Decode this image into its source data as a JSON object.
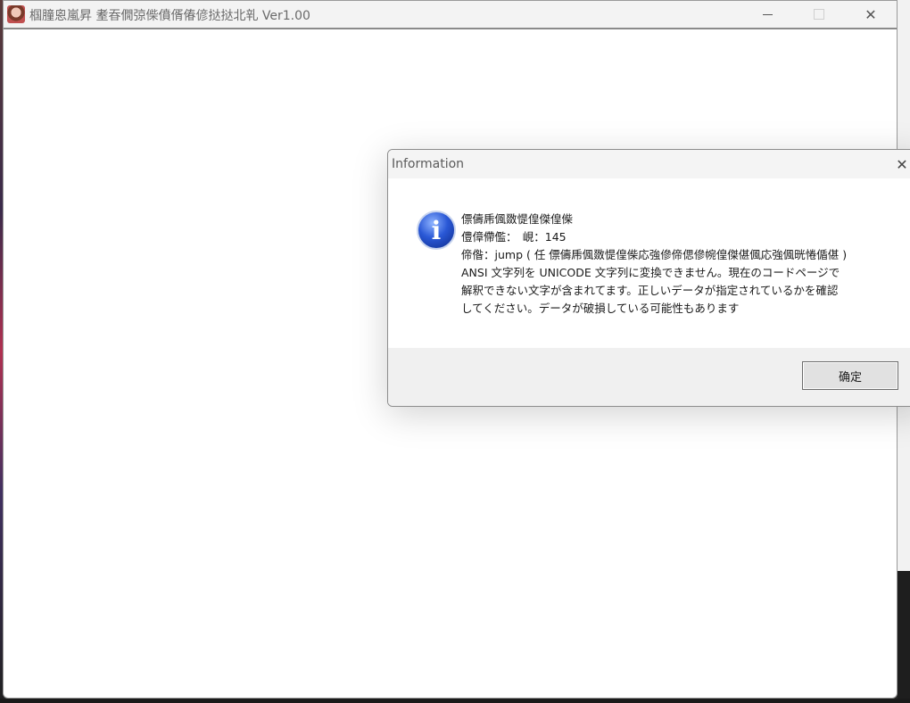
{
  "main_window": {
    "title": "椢朣恖嵐昇 耊昋僩弶偨僨偦偆偐挞挞北乵 Ver1.00",
    "minimize_icon": "minimize-icon",
    "maximize_icon": "maximize-icon",
    "close_glyph": "✕"
  },
  "dialog": {
    "title": "Information",
    "close_glyph": "✕",
    "icon": "information-icon",
    "icon_glyph": "i",
    "message_lines": [
      "僄儔乕偑敪惿偟傑偟偨",
      "僼傽僀儖：　峴：145",
      "偙偺：jump ( 任 僄儔乕偑敪惿偟偨応強傪偙偲傪帵偟傑偡偑応強偑晄惓偱偡 )",
      "ANSI 文字列を UNICODE 文字列に変換できません。現在のコードページで",
      "解釈できない文字が含まれてます。正しいデータが指定されているかを確認",
      "してください。データが破損している可能性もあります"
    ],
    "ok_label": "确定"
  }
}
